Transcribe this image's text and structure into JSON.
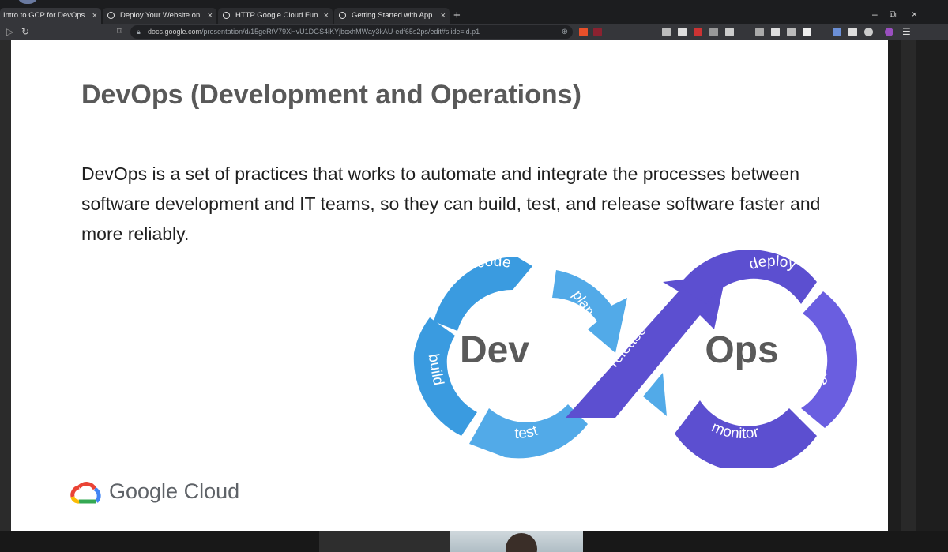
{
  "browser": {
    "tabs": [
      {
        "label": "Intro to GCP for DevOps - ",
        "active": true
      },
      {
        "label": "Deploy Your Website on C",
        "active": false
      },
      {
        "label": "HTTP Google Cloud Functi",
        "active": false
      },
      {
        "label": "Getting Started with App ",
        "active": false
      }
    ],
    "close_glyph": "×",
    "new_tab_glyph": "+",
    "window_controls": [
      "–",
      "⧉",
      "×"
    ],
    "url_host": "docs.google.com",
    "url_path": "/presentation/d/15geRtV79XHvU1DGS4iKYjbcxhMWay3kAU-edf65s2ps/edit#slide=id.p1",
    "icons": [
      "back-icon",
      "reload-icon",
      "bookmark-icon",
      "lock-icon",
      "zoom-icon",
      "extensions-icons",
      "menu-icon"
    ]
  },
  "slide": {
    "title": "DevOps (Development and Operations)",
    "body": "DevOps is a set of practices that works to automate and integrate the processes between software development and IT teams, so they can build, test, and release software faster and more reliably.",
    "logo_text": "Google Cloud",
    "logo_colors": [
      "#ea4335",
      "#4285f4",
      "#34a853",
      "#fbbc05"
    ]
  },
  "diagram": {
    "dev_label": "Dev",
    "ops_label": "Ops",
    "stages": {
      "code": "code",
      "plan": "plan",
      "build": "build",
      "test": "test",
      "release": "release",
      "deploy": "deploy",
      "operate": "operate",
      "monitor": "monitor"
    },
    "colors": {
      "dev": "#3a9be0",
      "dev_light": "#52aae8",
      "ops": "#5c4fd0",
      "ops_light": "#6a5ee0",
      "text": "#5a5a5a"
    }
  }
}
